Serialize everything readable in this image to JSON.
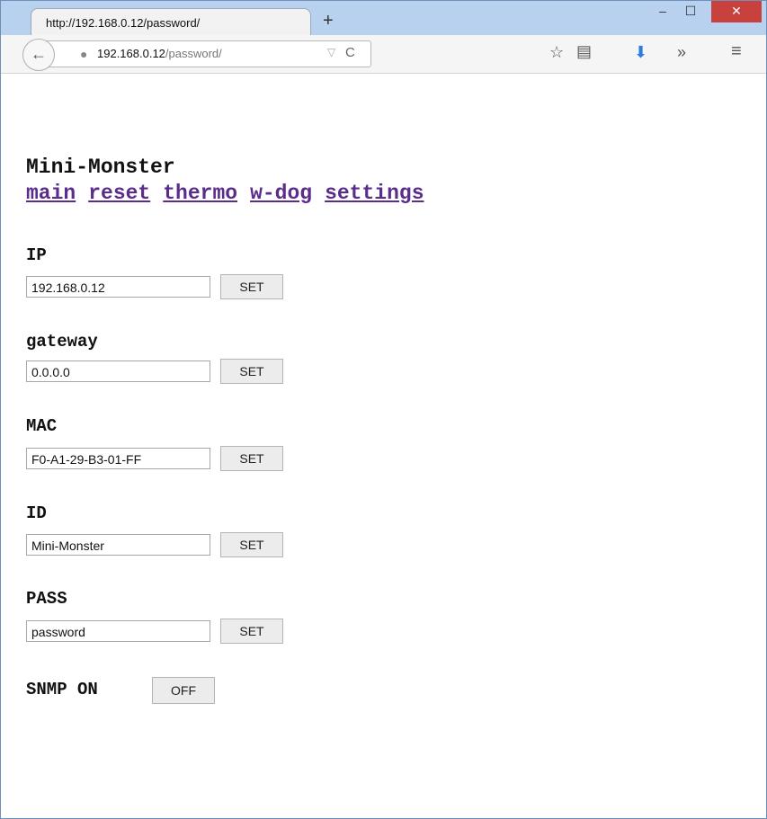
{
  "browser": {
    "tab_title": "http://192.168.0.12/password/",
    "url_host": "192.168.0.12",
    "url_path": "/password/",
    "new_tab_symbol": "+",
    "min_symbol": "‒",
    "max_symbol": "☐",
    "close_symbol": "✕",
    "back_symbol": "←",
    "reload_symbol": "C",
    "overflow_symbol": "»",
    "menu_symbol": "≡"
  },
  "page": {
    "title": "Mini-Monster",
    "nav": [
      "main",
      "reset",
      "thermo",
      "w-dog",
      "settings"
    ],
    "fields": [
      {
        "label": "IP",
        "value": "192.168.0.12",
        "button": "SET"
      },
      {
        "label": "gateway",
        "value": "0.0.0.0",
        "button": "SET"
      },
      {
        "label": "MAC",
        "value": "F0-A1-29-B3-01-FF",
        "button": "SET"
      },
      {
        "label": "ID",
        "value": "Mini-Monster",
        "button": "SET"
      },
      {
        "label": "PASS",
        "value": "password",
        "button": "SET"
      }
    ],
    "snmp": {
      "label": "SNMP ON",
      "button": "OFF"
    }
  },
  "colors": {
    "link": "#5a2c8c",
    "titlebar": "#b7d1ee",
    "close": "#c8413c"
  }
}
